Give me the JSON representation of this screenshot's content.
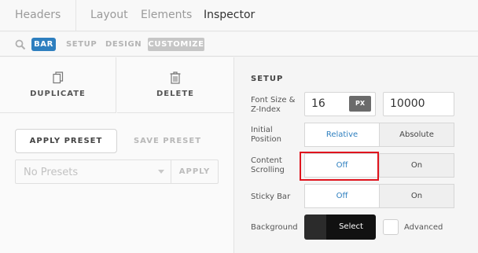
{
  "tabs": [
    "Headers",
    "Layout",
    "Elements",
    "Inspector"
  ],
  "breadcrumb": {
    "bar": "BAR",
    "setup": "SETUP",
    "design": "DESIGN",
    "customize": "CUSTOMIZE"
  },
  "left_panel": {
    "duplicate": "DUPLICATE",
    "delete": "DELETE",
    "apply_preset": "APPLY PRESET",
    "save_preset": "SAVE PRESET",
    "presets_placeholder": "No Presets",
    "apply": "APPLY"
  },
  "setup": {
    "title": "SETUP",
    "font_size_label_1": "Font Size &",
    "font_size_label_2": "Z-Index",
    "font_size_value": "16",
    "font_size_unit": "PX",
    "z_index_value": "10000",
    "initial_position_label_1": "Initial",
    "initial_position_label_2": "Position",
    "position_relative": "Relative",
    "position_absolute": "Absolute",
    "content_scrolling_label_1": "Content",
    "content_scrolling_label_2": "Scrolling",
    "scrolling_off": "Off",
    "scrolling_on": "On",
    "sticky_bar_label": "Sticky Bar",
    "sticky_off": "Off",
    "sticky_on": "On",
    "background_label": "Background",
    "background_select": "Select",
    "advanced_label": "Advanced"
  },
  "colors": {
    "accent": "#2e7fbf",
    "highlight": "#e0141e",
    "selected_crumb": "#2e7fbf"
  }
}
